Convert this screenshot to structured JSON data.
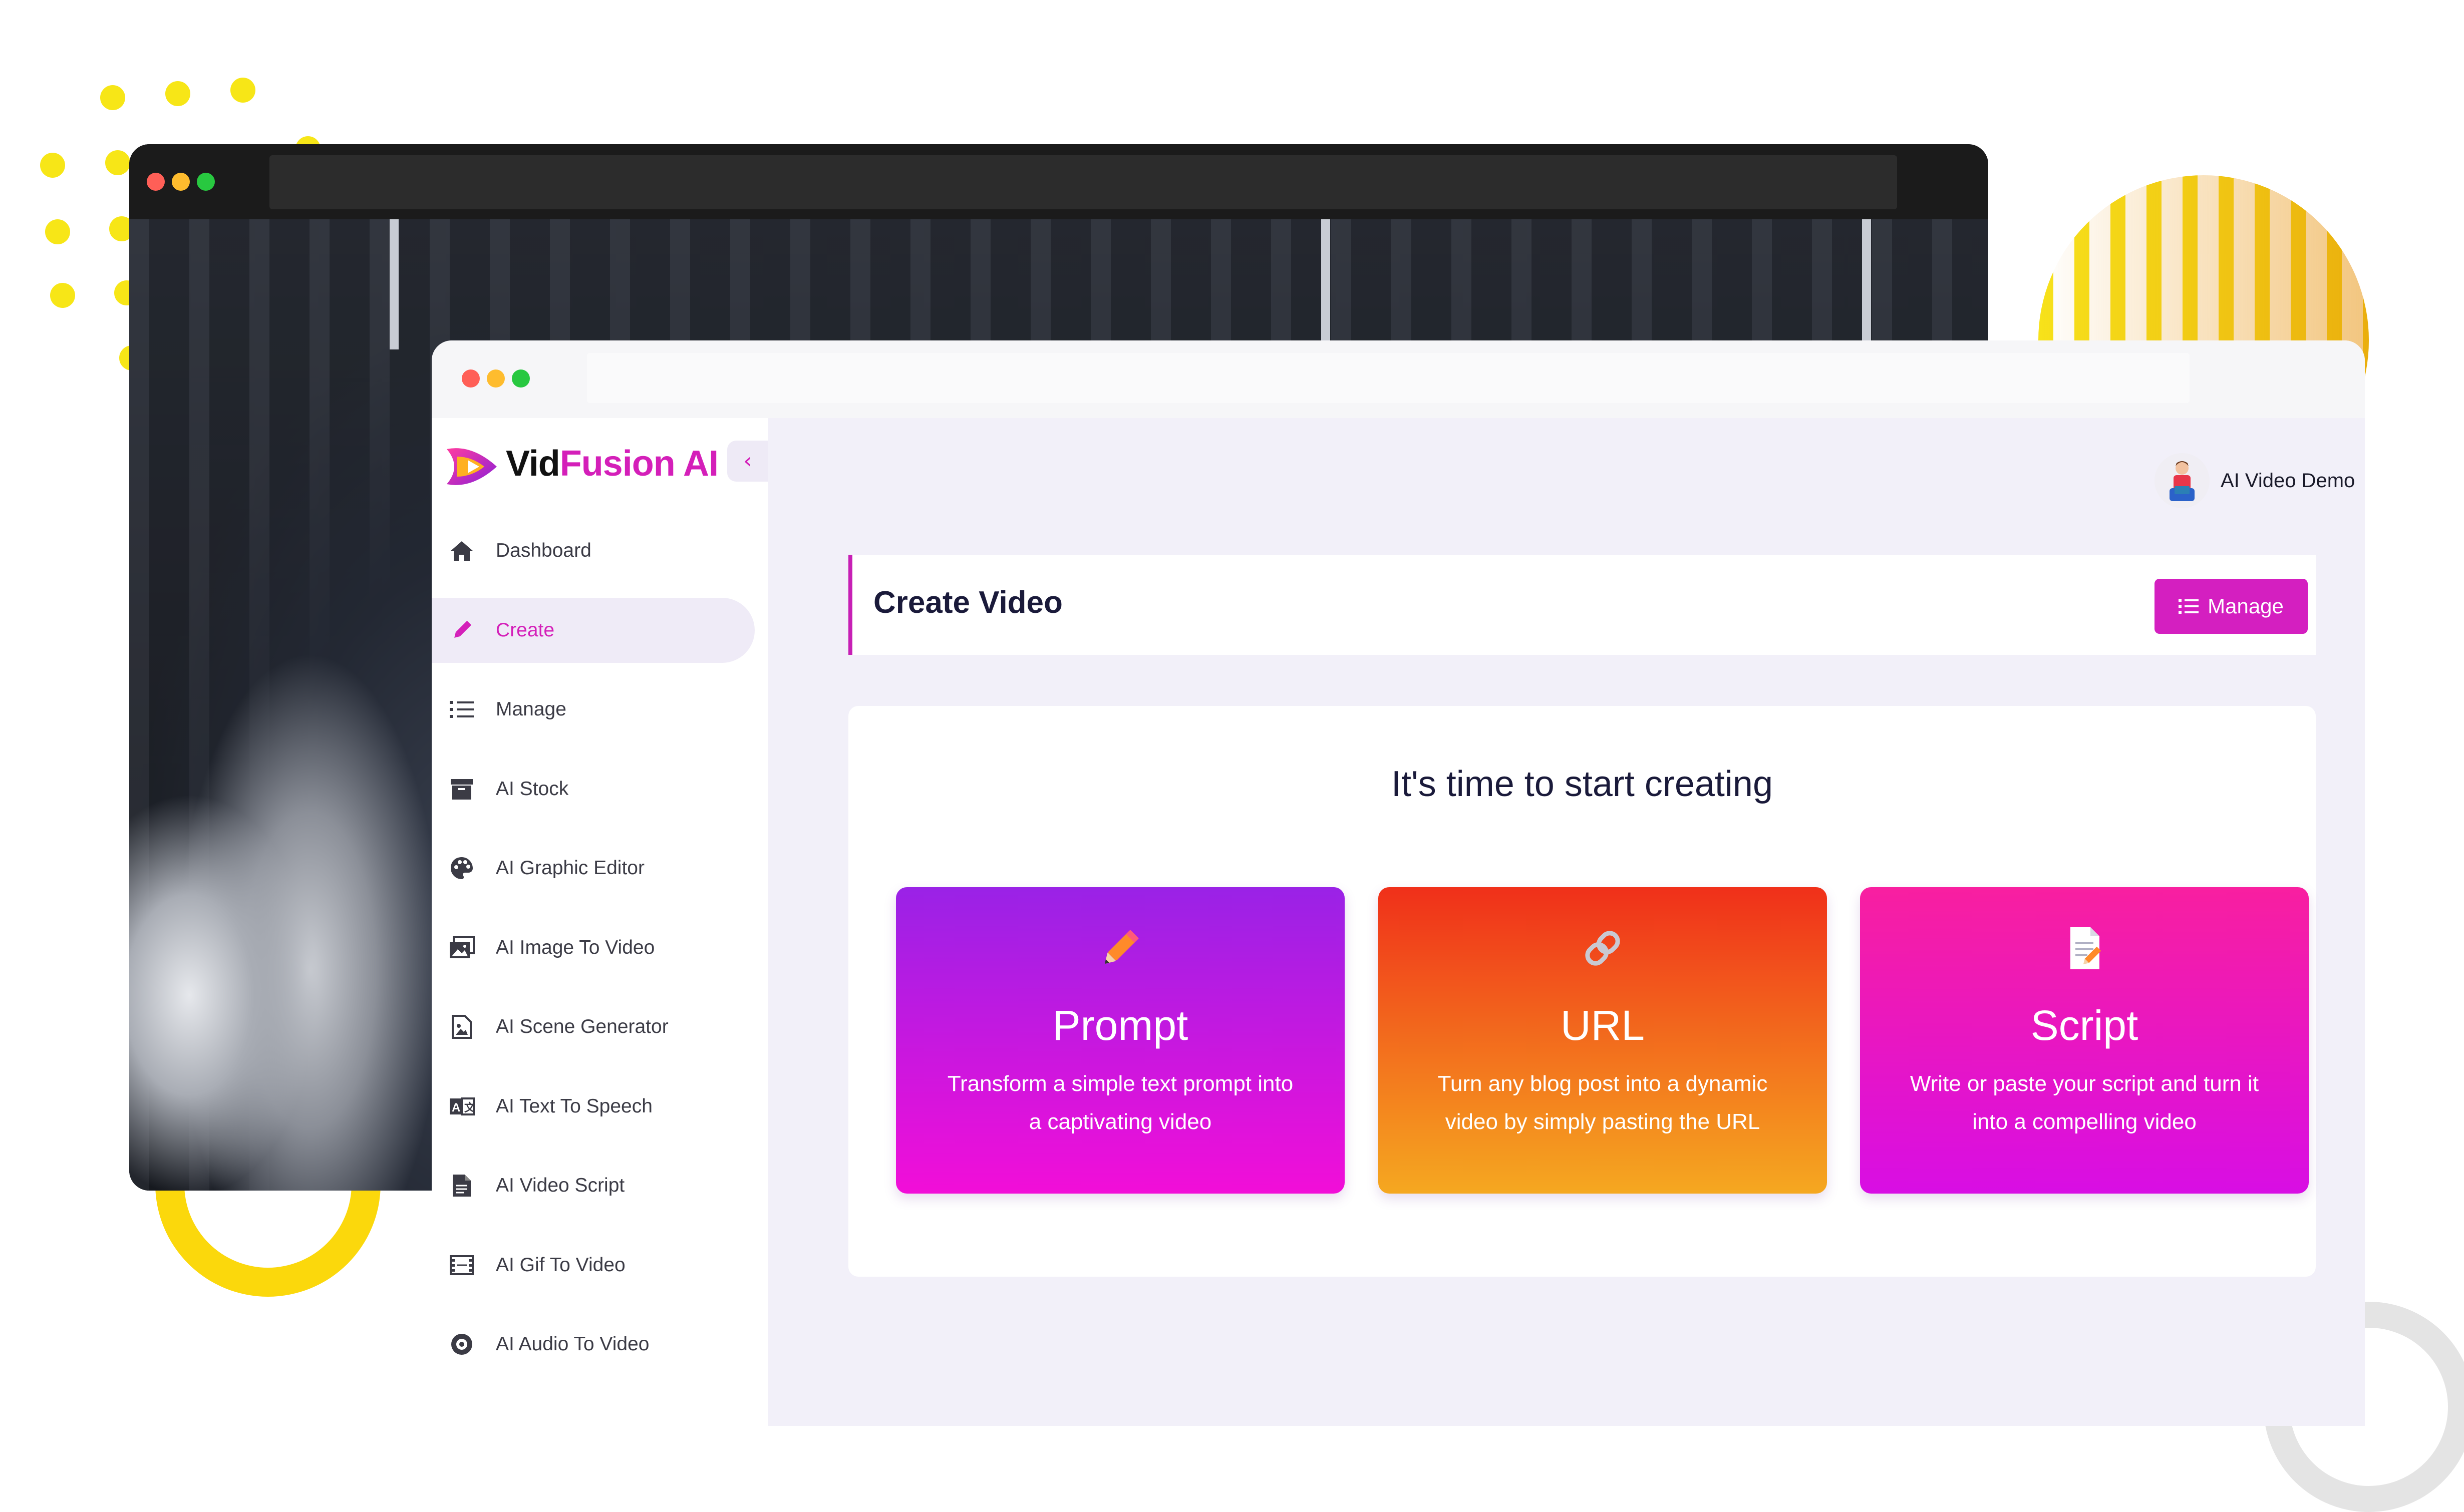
{
  "brand": {
    "name_part1": "Vid",
    "name_part2": "Fusion AI"
  },
  "colors": {
    "accent": "#d41fb9",
    "text_dark": "#1a1a3a"
  },
  "sidebar": {
    "collapse_icon": "chevron-left-icon",
    "items": [
      {
        "label": "Dashboard",
        "icon": "home-icon"
      },
      {
        "label": "Create",
        "icon": "pencil-icon",
        "active": true
      },
      {
        "label": "Manage",
        "icon": "list-icon"
      },
      {
        "label": "AI Stock",
        "icon": "archive-icon"
      },
      {
        "label": "AI Graphic Editor",
        "icon": "palette-icon"
      },
      {
        "label": "AI Image To Video",
        "icon": "images-icon"
      },
      {
        "label": "AI Scene Generator",
        "icon": "file-image-icon"
      },
      {
        "label": "AI Text To Speech",
        "icon": "language-icon"
      },
      {
        "label": "AI Video Script",
        "icon": "file-text-icon"
      },
      {
        "label": "AI Gif To Video",
        "icon": "film-icon"
      },
      {
        "label": "AI Audio To Video",
        "icon": "record-icon"
      }
    ]
  },
  "user": {
    "name": "AI Video Demo"
  },
  "page": {
    "title": "Create Video",
    "manage_label": "Manage"
  },
  "content": {
    "lead": "It's time to start creating",
    "options": [
      {
        "title": "Prompt",
        "desc_line1": "Transform a simple text prompt into",
        "desc_line2": "a captivating video",
        "icon": "pencil-icon"
      },
      {
        "title": "URL",
        "desc_line1": "Turn any blog post into a dynamic",
        "desc_line2": "video by simply pasting the URL",
        "icon": "link-icon"
      },
      {
        "title": "Script",
        "desc_line1": "Write or paste your script and turn it",
        "desc_line2": "into a compelling video",
        "icon": "memo-icon"
      }
    ]
  }
}
